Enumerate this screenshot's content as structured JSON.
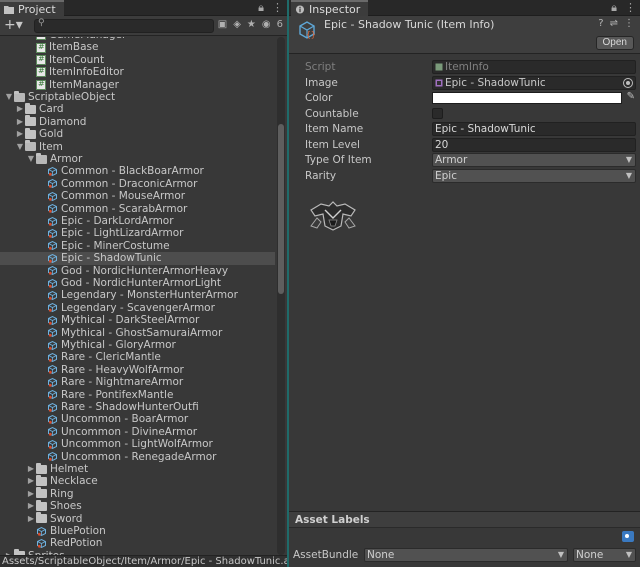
{
  "project": {
    "tab_label": "Project",
    "search_placeholder": "",
    "filter_count": "6",
    "path": "Assets/ScriptableObject/Item/Armor/Epic - ShadowTunic.asset",
    "tree": [
      {
        "label": "GameManager",
        "depth": 3,
        "kind": "script",
        "partial": true
      },
      {
        "label": "ItemBase",
        "depth": 3,
        "kind": "script"
      },
      {
        "label": "ItemCount",
        "depth": 3,
        "kind": "script"
      },
      {
        "label": "ItemInfoEditor",
        "depth": 3,
        "kind": "script"
      },
      {
        "label": "ItemManager",
        "depth": 3,
        "kind": "script"
      },
      {
        "label": "ScriptableObject",
        "depth": 1,
        "kind": "folder",
        "state": "open"
      },
      {
        "label": "Card",
        "depth": 2,
        "kind": "folder",
        "state": "closed"
      },
      {
        "label": "Diamond",
        "depth": 2,
        "kind": "folder",
        "state": "closed"
      },
      {
        "label": "Gold",
        "depth": 2,
        "kind": "folder",
        "state": "closed"
      },
      {
        "label": "Item",
        "depth": 2,
        "kind": "folder",
        "state": "open"
      },
      {
        "label": "Armor",
        "depth": 3,
        "kind": "folder",
        "state": "open"
      },
      {
        "label": "Common - BlackBoarArmor",
        "depth": 4,
        "kind": "asset"
      },
      {
        "label": "Common - DraconicArmor",
        "depth": 4,
        "kind": "asset"
      },
      {
        "label": "Common - MouseArmor",
        "depth": 4,
        "kind": "asset"
      },
      {
        "label": "Common - ScarabArmor",
        "depth": 4,
        "kind": "asset"
      },
      {
        "label": "Epic - DarkLordArmor",
        "depth": 4,
        "kind": "asset"
      },
      {
        "label": "Epic - LightLizardArmor",
        "depth": 4,
        "kind": "asset"
      },
      {
        "label": "Epic - MinerCostume",
        "depth": 4,
        "kind": "asset"
      },
      {
        "label": "Epic - ShadowTunic",
        "depth": 4,
        "kind": "asset",
        "selected": true
      },
      {
        "label": "God - NordicHunterArmorHeavy",
        "depth": 4,
        "kind": "asset"
      },
      {
        "label": "God - NordicHunterArmorLight",
        "depth": 4,
        "kind": "asset"
      },
      {
        "label": "Legendary - MonsterHunterArmor",
        "depth": 4,
        "kind": "asset"
      },
      {
        "label": "Legendary - ScavengerArmor",
        "depth": 4,
        "kind": "asset"
      },
      {
        "label": "Mythical - DarkSteelArmor",
        "depth": 4,
        "kind": "asset"
      },
      {
        "label": "Mythical - GhostSamuraiArmor",
        "depth": 4,
        "kind": "asset"
      },
      {
        "label": "Mythical - GloryArmor",
        "depth": 4,
        "kind": "asset"
      },
      {
        "label": "Rare - ClericMantle",
        "depth": 4,
        "kind": "asset"
      },
      {
        "label": "Rare - HeavyWolfArmor",
        "depth": 4,
        "kind": "asset"
      },
      {
        "label": "Rare - NightmareArmor",
        "depth": 4,
        "kind": "asset"
      },
      {
        "label": "Rare - PontifexMantle",
        "depth": 4,
        "kind": "asset"
      },
      {
        "label": "Rare - ShadowHunterOutfi",
        "depth": 4,
        "kind": "asset"
      },
      {
        "label": "Uncommon - BoarArmor",
        "depth": 4,
        "kind": "asset"
      },
      {
        "label": "Uncommon - DivineArmor",
        "depth": 4,
        "kind": "asset"
      },
      {
        "label": "Uncommon - LightWolfArmor",
        "depth": 4,
        "kind": "asset"
      },
      {
        "label": "Uncommon - RenegadeArmor",
        "depth": 4,
        "kind": "asset"
      },
      {
        "label": "Helmet",
        "depth": 3,
        "kind": "folder",
        "state": "closed"
      },
      {
        "label": "Necklace",
        "depth": 3,
        "kind": "folder",
        "state": "closed"
      },
      {
        "label": "Ring",
        "depth": 3,
        "kind": "folder",
        "state": "closed"
      },
      {
        "label": "Shoes",
        "depth": 3,
        "kind": "folder",
        "state": "closed"
      },
      {
        "label": "Sword",
        "depth": 3,
        "kind": "folder",
        "state": "closed"
      },
      {
        "label": "BluePotion",
        "depth": 3,
        "kind": "asset"
      },
      {
        "label": "RedPotion",
        "depth": 3,
        "kind": "asset"
      },
      {
        "label": "Sprites",
        "depth": 1,
        "kind": "folder",
        "state": "closed",
        "partial": true
      }
    ]
  },
  "inspector": {
    "tab_label": "Inspector",
    "title": "Epic - Shadow Tunic (Item Info)",
    "open_label": "Open",
    "properties": {
      "script": {
        "label": "Script",
        "value": "ItemInfo"
      },
      "image": {
        "label": "Image",
        "value": "Epic - ShadowTunic"
      },
      "color": {
        "label": "Color",
        "value": "#ffffff"
      },
      "countable": {
        "label": "Countable",
        "checked": false
      },
      "item_name": {
        "label": "Item Name",
        "value": "Epic - ShadowTunic"
      },
      "item_level": {
        "label": "Item Level",
        "value": "20"
      },
      "type_of_item": {
        "label": "Type Of Item",
        "value": "Armor"
      },
      "rarity": {
        "label": "Rarity",
        "value": "Epic"
      }
    },
    "asset_labels": "Asset Labels",
    "asset_bundle": {
      "label": "AssetBundle",
      "name": "None",
      "variant": "None"
    }
  },
  "colors": {
    "panel_bg": "#383838",
    "divider": "#1f6b6a",
    "selection": "#4d4d4d",
    "tag_button": "#3a79c0"
  }
}
